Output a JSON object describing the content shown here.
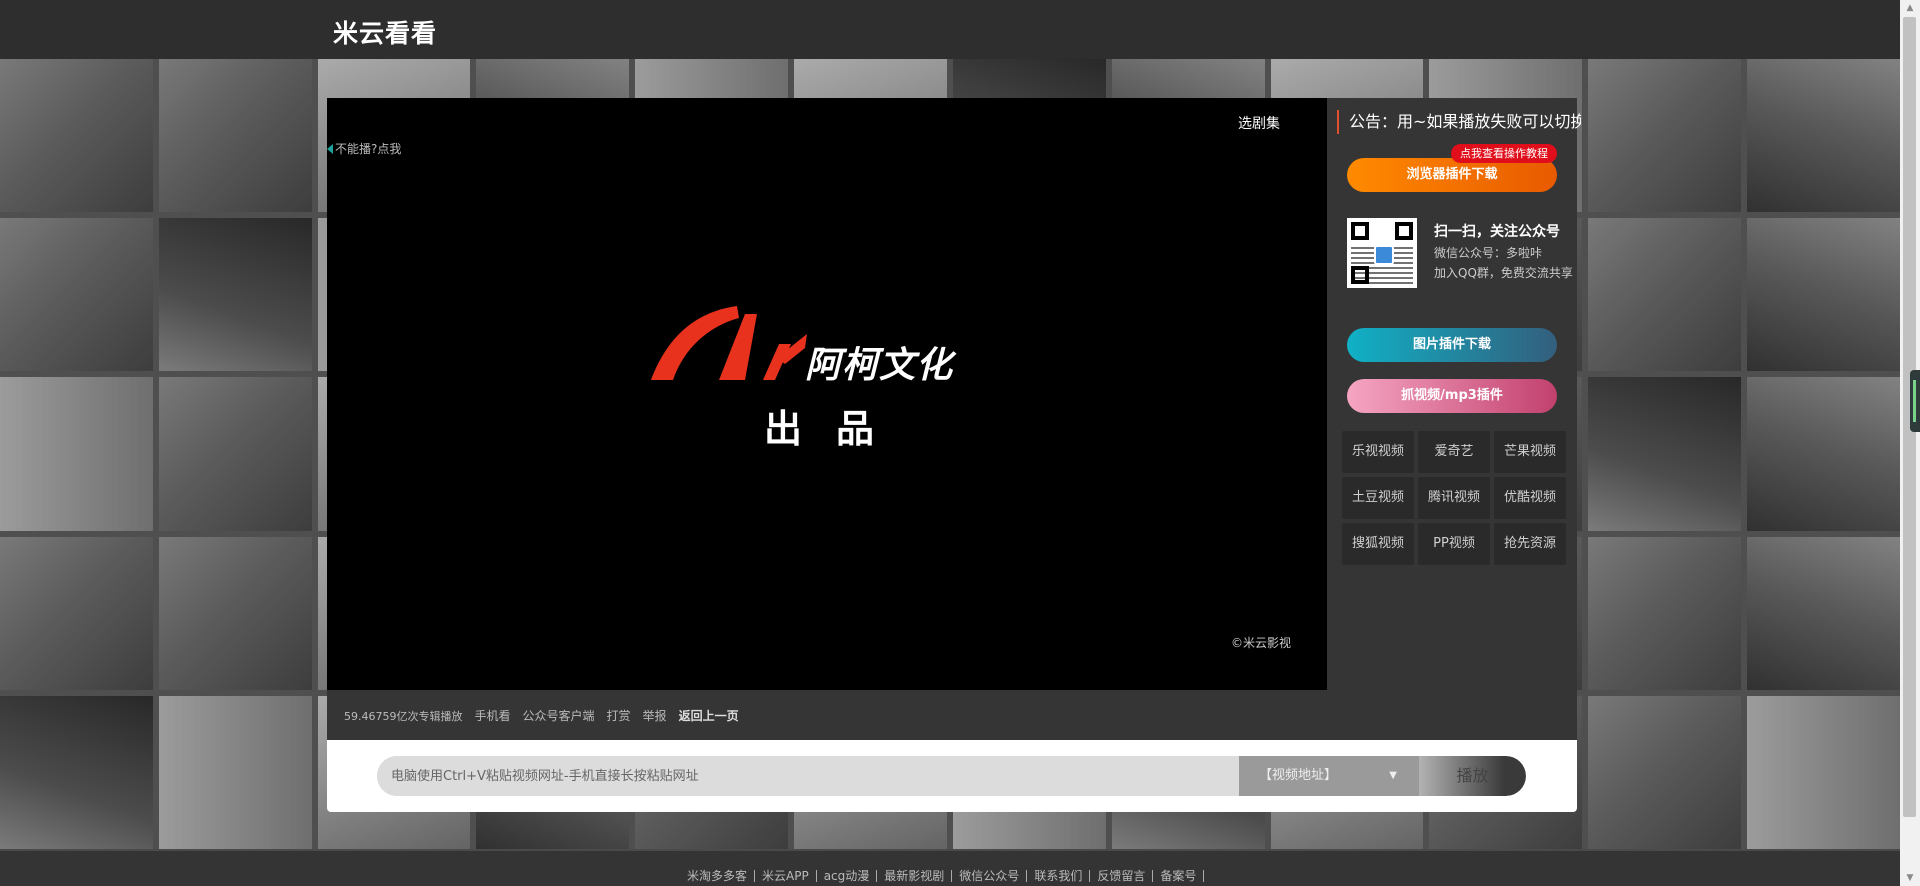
{
  "site": {
    "title": "米云看看"
  },
  "player": {
    "select_episode": "选剧集",
    "cant_play": "不能播?点我",
    "brand_name": "阿柯文化",
    "brand_sub": "出品",
    "copyright": "©米云影视"
  },
  "sidebar": {
    "notice": "公告：用~如果播放失败可以切换",
    "browser_plugin_btn": "浏览器插件下载",
    "browser_plugin_badge": "点我查看操作教程",
    "wechat_title": "扫一扫，关注公众号",
    "wechat_line1": "微信公众号：多啦咔",
    "wechat_line2": "加入QQ群，免费交流共享",
    "image_plugin_btn": "图片插件下载",
    "capture_plugin_btn": "抓视频/mp3插件",
    "platforms": [
      "乐视视频",
      "爱奇艺",
      "芒果视频",
      "土豆视频",
      "腾讯视频",
      "优酷视频",
      "搜狐视频",
      "PP视频",
      "抢先资源"
    ]
  },
  "info_bar": {
    "play_count": "59.46759亿次专辑播放",
    "items": [
      "手机看",
      "公众号客户端",
      "打赏",
      "举报"
    ],
    "back": "返回上一页"
  },
  "search": {
    "placeholder": "电脑使用Ctrl+V粘贴视频网址-手机直接长按粘贴网址",
    "source_label": "【视频地址】",
    "play_label": "播放"
  },
  "footer": {
    "links": [
      "米淘多多客",
      "米云APP",
      "acg动漫",
      "最新影视剧",
      "微信公众号",
      "联系我们",
      "反馈留言",
      "备案号"
    ]
  },
  "colors": {
    "accent_orange": "#ff8a00",
    "badge_red": "#e00e1a",
    "brand_red": "#e8321d",
    "teal": "#10b1c6",
    "pink": "#f5a5c2"
  }
}
